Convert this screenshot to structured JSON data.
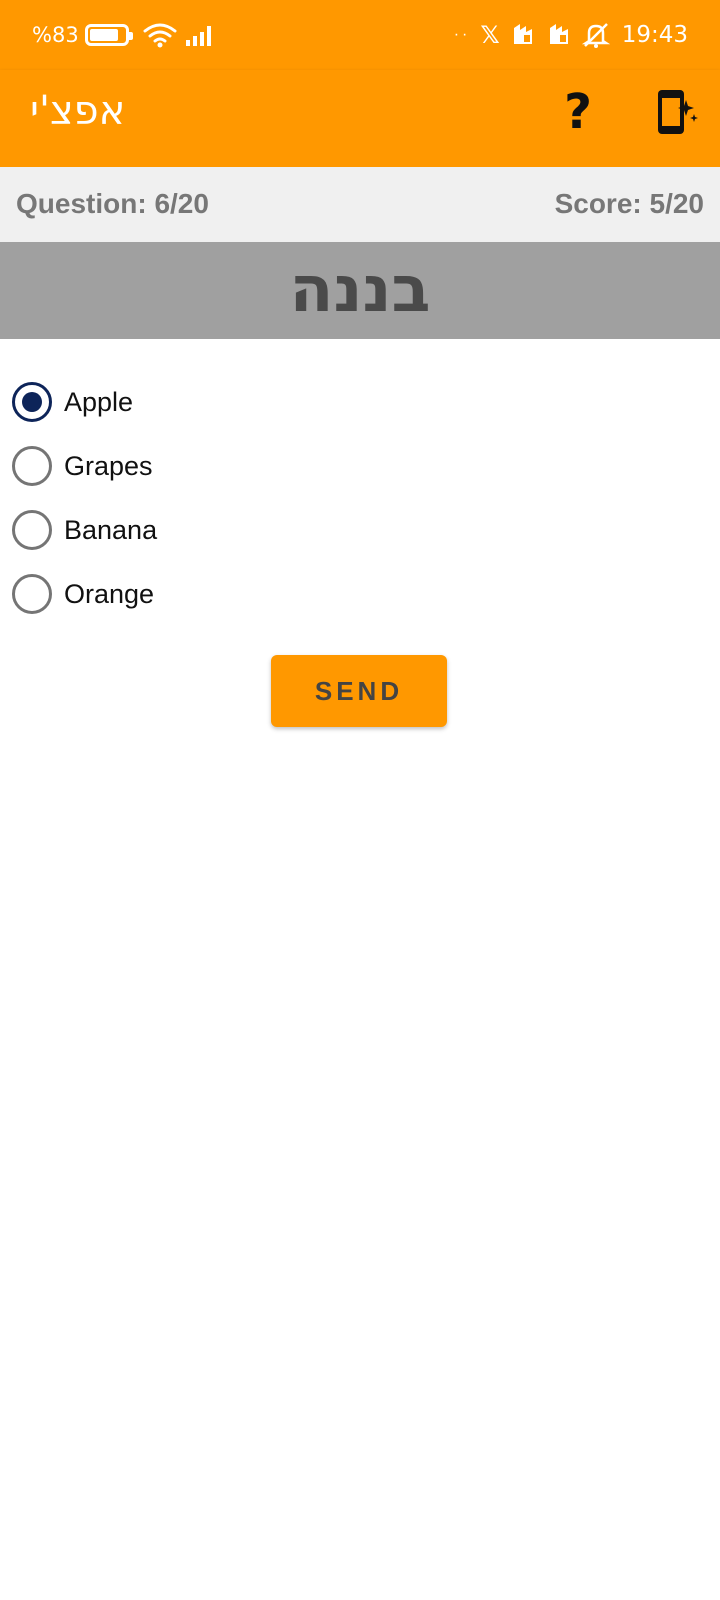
{
  "status_bar": {
    "battery_text": "%83",
    "battery_level": 0.83,
    "dots": "··",
    "x_glyph": "𝕏",
    "time": "19:43",
    "icons": [
      "battery-icon",
      "wifi-icon",
      "signal-icon",
      "x-app-icon",
      "notification-icon",
      "notification-icon",
      "alarm-off-icon"
    ]
  },
  "app_bar": {
    "title": "אפצ'י",
    "help_label": "?",
    "help_icon": "question-icon",
    "action_icon": "phone-sparkle-icon"
  },
  "quiz": {
    "question_progress": "Question: 6/20",
    "score": "Score: 5/20",
    "word": "בננה"
  },
  "options": [
    {
      "label": "Apple",
      "selected": true
    },
    {
      "label": "Grapes",
      "selected": false
    },
    {
      "label": "Banana",
      "selected": false
    },
    {
      "label": "Orange",
      "selected": false
    }
  ],
  "send_label": "SEND",
  "colors": {
    "accent": "#FF9800",
    "radio_selected": "#0D2459",
    "info_bar": "#F0F0F0",
    "word_banner": "#A0A0A0"
  }
}
